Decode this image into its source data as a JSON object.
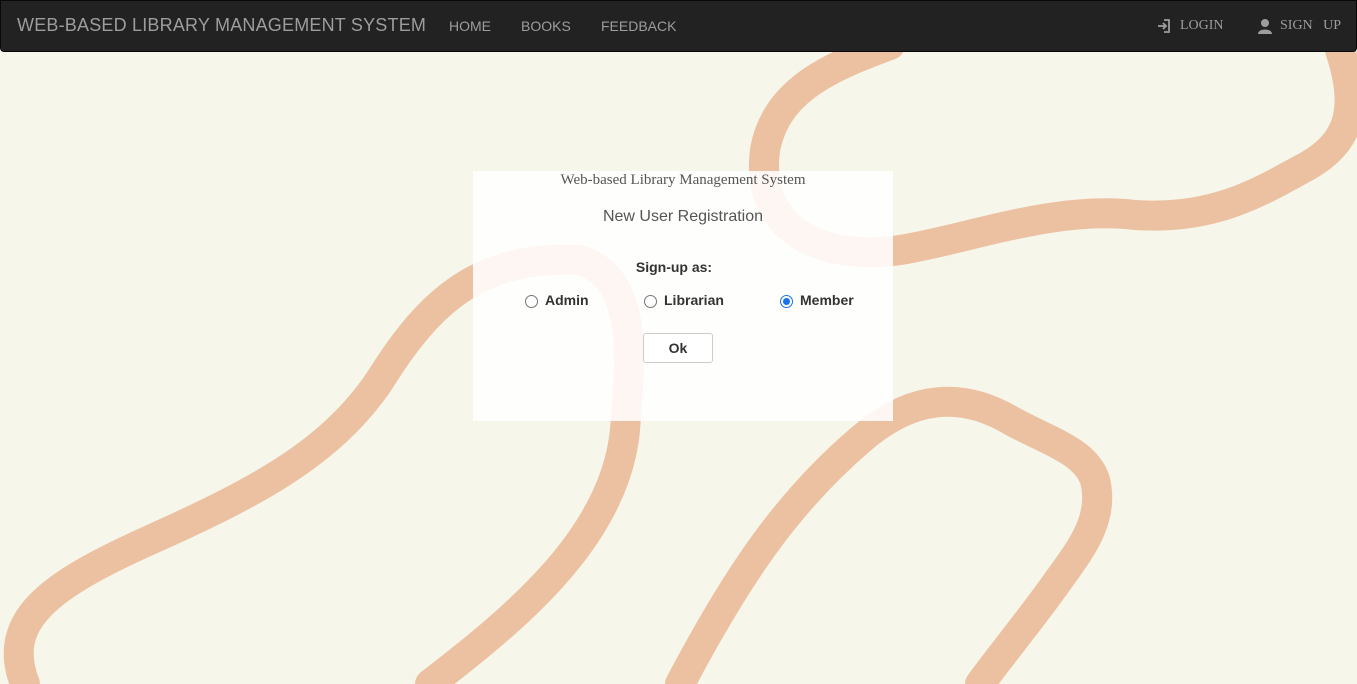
{
  "navbar": {
    "brand": "WEB-BASED LIBRARY MANAGEMENT SYSTEM",
    "links": [
      {
        "label": "HOME"
      },
      {
        "label": "BOOKS"
      },
      {
        "label": "FEEDBACK"
      }
    ],
    "right": {
      "login": {
        "label": "LOGIN",
        "icon": "login-icon"
      },
      "signup": {
        "label": "SIGN   UP",
        "icon": "user-icon"
      }
    },
    "bg_color": "#222222",
    "text_color": "#9d9d9d"
  },
  "registration": {
    "system_title": "Web-based Library Management System",
    "title": "New User Registration",
    "signup_label": "Sign-up as:",
    "options": [
      {
        "label": "Admin",
        "selected": false
      },
      {
        "label": "Librarian",
        "selected": false
      },
      {
        "label": "Member",
        "selected": true
      }
    ],
    "ok_label": "Ok"
  },
  "theme": {
    "background": "#f6f6ea",
    "wave_color": "#ecc1a2",
    "radio_accent": "#1a73e8"
  }
}
